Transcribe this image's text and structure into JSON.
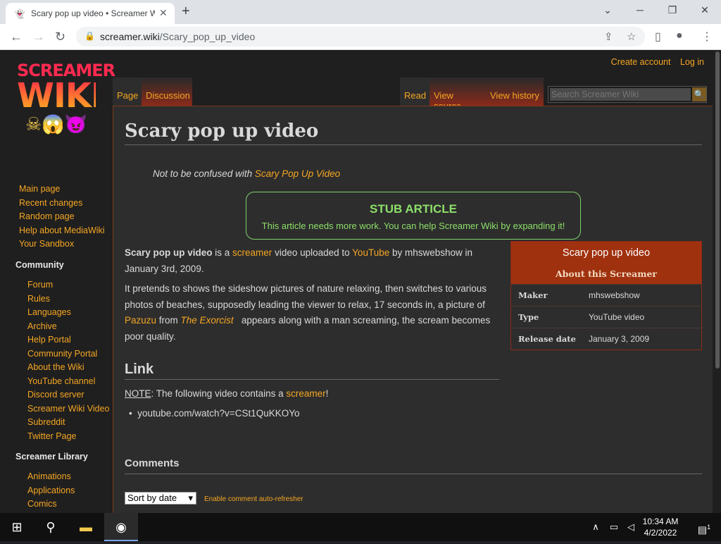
{
  "browser": {
    "tab_title": "Scary pop up video • Screamer Wiki",
    "tab_favicon": "ghost-icon",
    "url_host": "screamer.wiki",
    "url_path": "/Scary_pop_up_video",
    "new_tab": "+",
    "close_tab": "✕",
    "minimize": "⌄",
    "maximize": "─",
    "restore": "❐",
    "close": "✕"
  },
  "wiki": {
    "logo_line1": "SCREAMER",
    "logo_line2": "WIKI",
    "logo_emoji": "☠😱😈",
    "create_account": "Create account",
    "log_in": "Log in",
    "nav": [
      "Main page",
      "Recent changes",
      "Random page",
      "Help about MediaWiki",
      "Your Sandbox"
    ],
    "community_heading": "Community",
    "community": [
      "Forum",
      "Rules",
      "Languages",
      "Archive",
      "Help Portal",
      "Community Portal",
      "About the Wiki",
      "YouTube channel",
      "Discord server",
      "Screamer Wiki Video",
      "Subreddit",
      "Twitter Page"
    ],
    "library_heading": "Screamer Library",
    "library": [
      "Animations",
      "Applications",
      "Comics"
    ],
    "tabs_left": [
      "Page",
      "Discussion"
    ],
    "tabs_right": [
      "Read",
      "View source",
      "View history"
    ],
    "search_placeholder": "Search Screamer Wiki",
    "search_button": "🔍"
  },
  "article": {
    "title": "Scary pop up video",
    "hatnote_prefix": "Not to be confused with ",
    "hatnote_link": "Scary Pop Up Video",
    "stub_heading": "STUB ARTICLE",
    "stub_text": "This article needs more work. You can help Screamer Wiki by expanding it!",
    "p1_bold": "Scary pop up video",
    "p1_a": " is a ",
    "p1_link1": "screamer",
    "p1_b": " video uploaded to ",
    "p1_link2": "YouTube",
    "p1_c": " by mhswebshow in January 3rd, 2009.",
    "p2_a": "It pretends to shows the sideshow pictures of nature relaxing, then switches to various photos of beaches, supposedly leading the viewer to relax, 17 seconds in, a picture of ",
    "p2_link1": "Pazuzu",
    "p2_b": " from ",
    "p2_link2": "The Exorcist",
    "p2_c": "   appears along with a man screaming, the scream becomes poor quality.",
    "link_heading": "Link",
    "note_label": "NOTE",
    "note_text": ": The following video contains a ",
    "note_link": "screamer",
    "note_end": "!",
    "video_url": "youtube.com/watch?v=CSt1QuKKOYo",
    "comments_heading": "Comments",
    "sort_value": "Sort by date",
    "auto_refresh": "Enable comment auto-refresher"
  },
  "infobox": {
    "title": "Scary pop up video",
    "subtitle": "About this Screamer",
    "rows": [
      {
        "k": "Maker",
        "v": "mhswebshow"
      },
      {
        "k": "Type",
        "v": "YouTube video"
      },
      {
        "k": "Release date",
        "v": "January 3, 2009"
      }
    ]
  },
  "taskbar": {
    "time": "10:34 AM",
    "date": "4/2/2022",
    "notif_count": "1"
  }
}
